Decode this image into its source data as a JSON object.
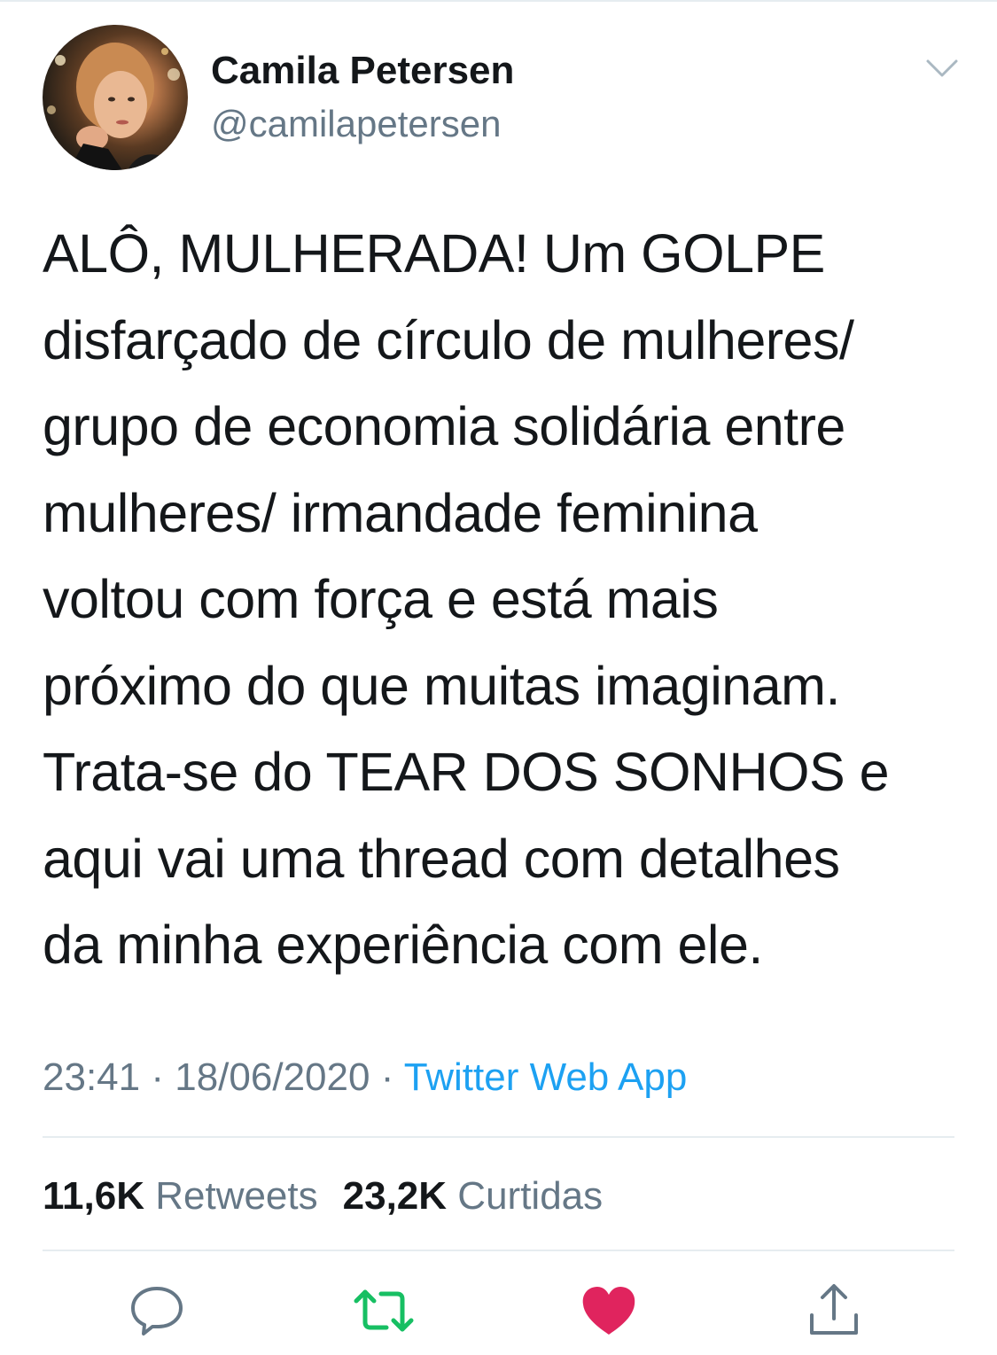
{
  "tweet": {
    "author": {
      "display_name": "Camila Petersen",
      "handle": "@camilapetersen"
    },
    "text_lines": [
      "ALÔ, MULHERADA! Um GOLPE",
      "disfarçado de círculo de mulheres/",
      "grupo de economia solidária entre",
      "mulheres/ irmandade feminina",
      "voltou com força e está mais",
      "próximo do que muitas imaginam.",
      "Trata-se do TEAR DOS SONHOS e",
      "aqui vai uma thread com detalhes",
      "da minha experiência com ele."
    ],
    "meta": {
      "time": "23:41",
      "separator": "·",
      "date": "18/06/2020",
      "source": "Twitter Web App"
    },
    "stats": {
      "retweets_count": "11,6K",
      "retweets_label": "Retweets",
      "likes_count": "23,2K",
      "likes_label": "Curtidas"
    },
    "actions": [
      {
        "name": "reply",
        "icon": "speech-bubble-icon",
        "color": "#657786"
      },
      {
        "name": "retweet",
        "icon": "retweet-arrows-icon",
        "color": "#17bf63"
      },
      {
        "name": "like",
        "icon": "heart-icon",
        "color": "#e0245e"
      },
      {
        "name": "share",
        "icon": "share-upload-icon",
        "color": "#657786"
      }
    ]
  },
  "colors": {
    "text": "#14171a",
    "secondary": "#657786",
    "link": "#1da1f2",
    "divider": "#e6ecf0",
    "retweet_green": "#17bf63",
    "like_red": "#e0245e"
  }
}
